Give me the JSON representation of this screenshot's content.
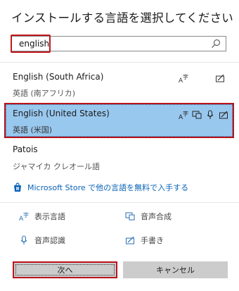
{
  "dialog": {
    "title": "インストールする言語を選択してください"
  },
  "search": {
    "value": "english",
    "icon": "search-icon"
  },
  "languages": [
    {
      "name": "English (South Africa)",
      "native": "英語 (南アフリカ)",
      "features": [
        "display-language-icon",
        "handwriting-icon"
      ],
      "selected": false
    },
    {
      "name": "English (United States)",
      "native": "英語 (米国)",
      "features": [
        "display-language-icon",
        "text-to-speech-icon",
        "speech-recognition-icon",
        "handwriting-icon"
      ],
      "selected": true
    },
    {
      "name": "Patois",
      "native": "ジャマイカ クレオール語",
      "features": [],
      "selected": false
    }
  ],
  "store_link": {
    "label": "Microsoft Store で他の言語を無料で入手する",
    "icon": "store-icon"
  },
  "legend": {
    "display_language": "表示言語",
    "text_to_speech": "音声合成",
    "speech_recognition": "音声認識",
    "handwriting": "手書き"
  },
  "buttons": {
    "next": "次へ",
    "cancel": "キャンセル"
  },
  "colors": {
    "selection": "#99c8ef",
    "highlight_border": "#b9151c",
    "link": "#0a63b8"
  }
}
